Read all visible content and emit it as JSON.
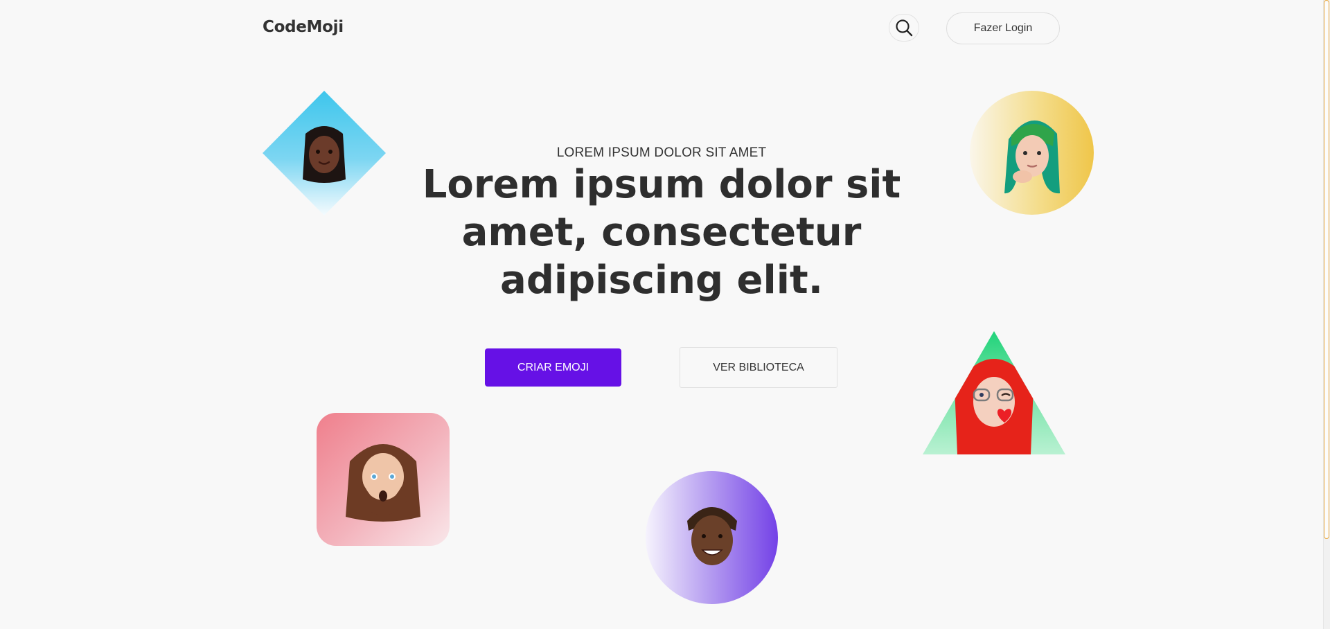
{
  "header": {
    "logo": "CodeMoji",
    "search_icon": "search-icon",
    "login_label": "Fazer Login"
  },
  "hero": {
    "eyebrow": "LOREM IPSUM DOLOR SIT AMET",
    "headline": "Lorem ipsum dolor sit amet, consectetur adipiscing elit.",
    "primary_cta": "CRIAR EMOJI",
    "secondary_cta": "VER BIBLIOTECA"
  },
  "avatars": [
    {
      "name": "avatar-diamond-blue",
      "shape": "diamond",
      "color": "#3ec6ec"
    },
    {
      "name": "avatar-circle-yellow",
      "shape": "circle",
      "color": "#efc64a"
    },
    {
      "name": "avatar-triangle-green",
      "shape": "triangle",
      "color": "#20d37a"
    },
    {
      "name": "avatar-square-pink",
      "shape": "rounded-square",
      "color": "#ef7f8c"
    },
    {
      "name": "avatar-circle-purple",
      "shape": "circle",
      "color": "#7442e7"
    }
  ],
  "colors": {
    "accent": "#6611e6",
    "background": "#f8f8f8",
    "text": "#2f2f2f"
  }
}
